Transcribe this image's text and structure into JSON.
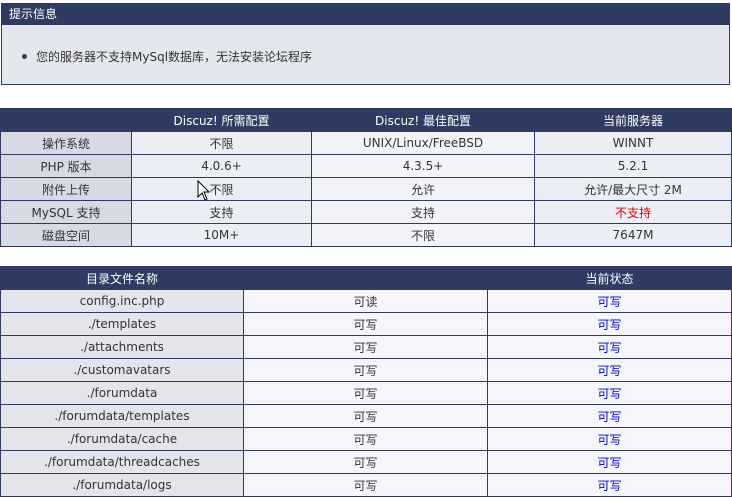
{
  "notice": {
    "title": "提示信息",
    "message": "您的服务器不支持MySql数据库，无法安装论坛程序"
  },
  "env_table": {
    "headers": [
      "",
      "Discuz! 所需配置",
      "Discuz! 最佳配置",
      "当前服务器"
    ],
    "rows": [
      {
        "label": "操作系统",
        "required": "不限",
        "best": "UNIX/Linux/FreeBSD",
        "current": "WINNT",
        "ok": true
      },
      {
        "label": "PHP 版本",
        "required": "4.0.6+",
        "best": "4.3.5+",
        "current": "5.2.1",
        "ok": true
      },
      {
        "label": "附件上传",
        "required": "不限",
        "best": "允许",
        "current": "允许/最大尺寸 2M",
        "ok": true
      },
      {
        "label": "MySQL 支持",
        "required": "支持",
        "best": "支持",
        "current": "不支持",
        "ok": false
      },
      {
        "label": "磁盘空间",
        "required": "10M+",
        "best": "不限",
        "current": "7647M",
        "ok": true
      }
    ]
  },
  "dir_table": {
    "headers": [
      "目录文件名称",
      "",
      "当前状态"
    ],
    "rows": [
      {
        "name": "config.inc.php",
        "required": "可读",
        "current": "可写"
      },
      {
        "name": "./templates",
        "required": "可写",
        "current": "可写"
      },
      {
        "name": "./attachments",
        "required": "可写",
        "current": "可写"
      },
      {
        "name": "./customavatars",
        "required": "可写",
        "current": "可写"
      },
      {
        "name": "./forumdata",
        "required": "可写",
        "current": "可写"
      },
      {
        "name": "./forumdata/templates",
        "required": "可写",
        "current": "可写"
      },
      {
        "name": "./forumdata/cache",
        "required": "可写",
        "current": "可写"
      },
      {
        "name": "./forumdata/threadcaches",
        "required": "可写",
        "current": "可写"
      },
      {
        "name": "./forumdata/logs",
        "required": "可写",
        "current": "可写"
      }
    ]
  },
  "colors": {
    "header_bg": "#303b62",
    "error": "#e00000",
    "status_link": "#0000cc"
  }
}
